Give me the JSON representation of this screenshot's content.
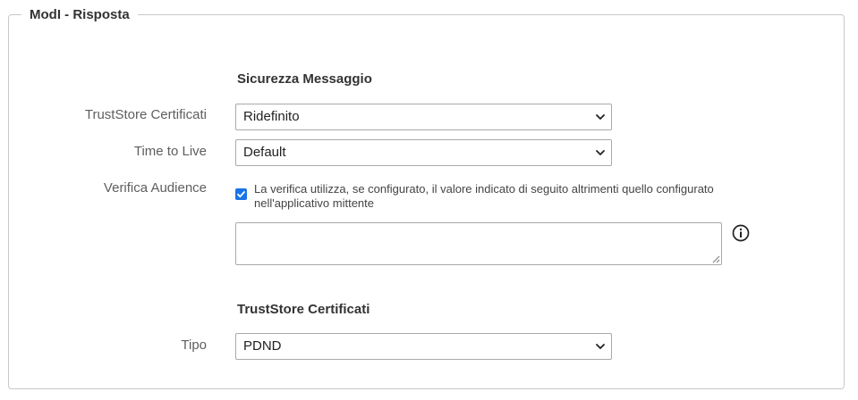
{
  "fieldset": {
    "legend": "ModI - Risposta"
  },
  "sicurezza": {
    "title": "Sicurezza Messaggio",
    "truststore_label": "TrustStore Certificati",
    "truststore_value": "Ridefinito",
    "ttl_label": "Time to Live",
    "ttl_value": "Default",
    "audience_label": "Verifica Audience",
    "audience_checked": true,
    "audience_text_line1": "La verifica utilizza, se configurato, il valore indicato di seguito altrimenti quello configurato",
    "audience_text_line2": "nell'applicativo mittente",
    "audience_value": ""
  },
  "truststore": {
    "title": "TrustStore Certificati",
    "tipo_label": "Tipo",
    "tipo_value": "PDND"
  },
  "icons": {
    "dropdown": "chevron-down-icon",
    "info": "info-icon",
    "checkbox": "checkmark-icon"
  },
  "colors": {
    "accent": "#1a73e8",
    "border": "#a9a9a9"
  }
}
